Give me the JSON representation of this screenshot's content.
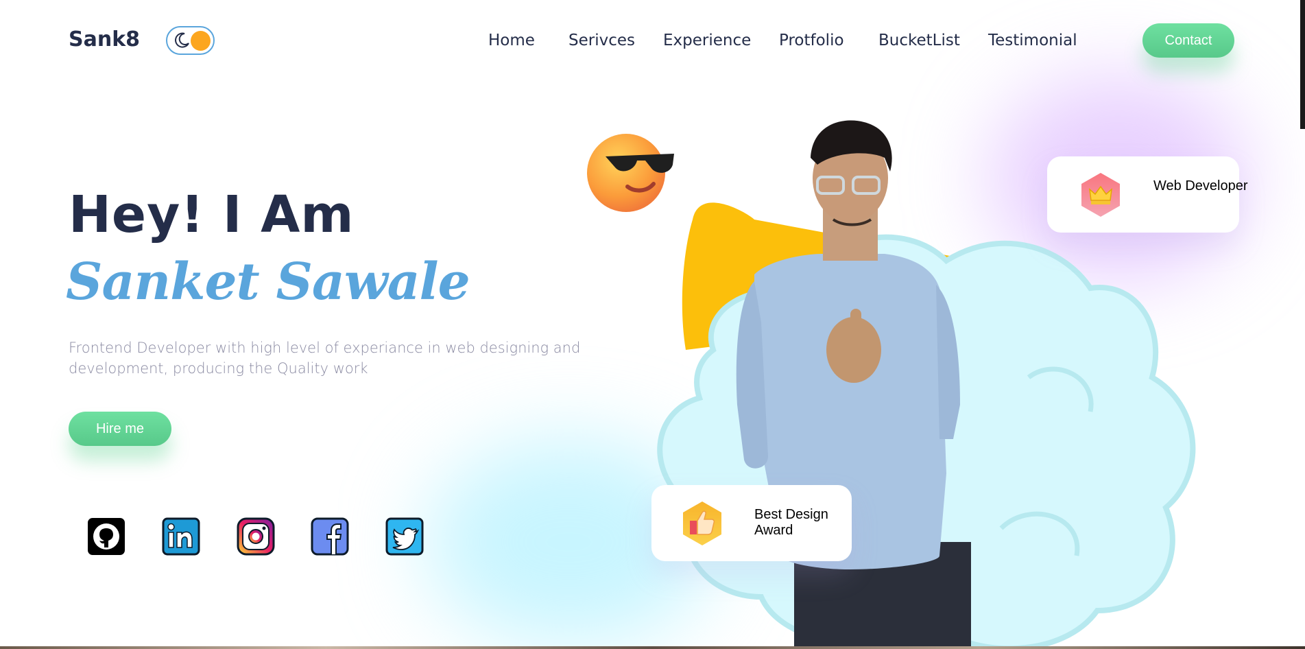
{
  "header": {
    "logo": "Sank8",
    "theme_toggle": {
      "state": "light",
      "moon_icon": "moon-icon"
    },
    "nav": [
      "Home",
      "Serivces",
      "Experience",
      "Protfolio",
      "BucketList",
      "Testimonial"
    ],
    "contact_label": "Contact"
  },
  "hero": {
    "greeting": "Hey! I Am",
    "name": "Sanket Sawale",
    "description": "Frontend Developer with high level of experiance in web designing and development, producing the Quality work",
    "hire_label": "Hire me"
  },
  "social": [
    {
      "name": "github",
      "icon": "github-icon"
    },
    {
      "name": "linkedin",
      "icon": "linkedin-icon"
    },
    {
      "name": "instagram",
      "icon": "instagram-icon"
    },
    {
      "name": "facebook",
      "icon": "facebook-icon"
    },
    {
      "name": "twitter",
      "icon": "twitter-icon"
    }
  ],
  "cards": {
    "web_developer": {
      "label": "Web Developer",
      "icon": "crown-icon"
    },
    "award": {
      "label": "Best Design Award",
      "icon": "thumbs-up-icon"
    }
  },
  "colors": {
    "primary_text": "#242d49",
    "accent_blue": "#5aa5dc",
    "accent_orange": "#fca61f",
    "button_green": "#58c98a",
    "cloud_cyan": "#d6f8fd",
    "blob_yellow": "#fcbf0b"
  }
}
